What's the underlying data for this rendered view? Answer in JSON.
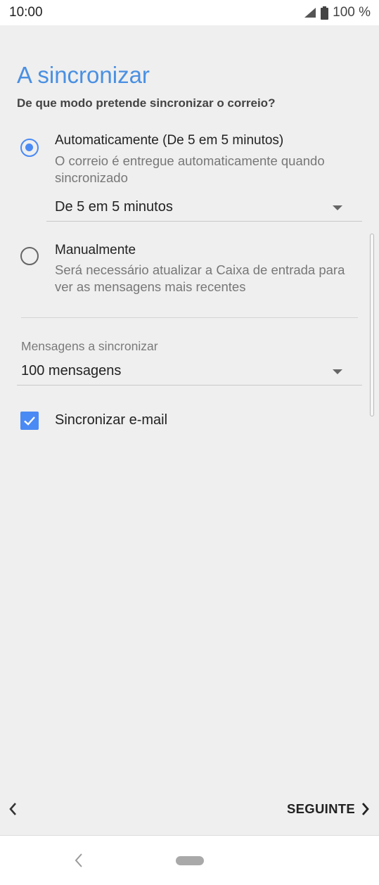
{
  "status_bar": {
    "time": "10:00",
    "battery": "100 %",
    "icons": [
      "signal-icon",
      "battery-icon"
    ]
  },
  "page": {
    "title": "A sincronizar",
    "subtitle": "De que modo pretende sincronizar o correio?"
  },
  "sync_options": [
    {
      "title": "Automaticamente (De 5 em 5 minutos)",
      "description": "O correio é entregue automaticamente quando sincronizado",
      "selected": true
    },
    {
      "title": "Manualmente",
      "description": "Será necessário atualizar a Caixa de entrada para ver as mensagens mais recentes",
      "selected": false
    }
  ],
  "interval_dropdown": {
    "value": "De 5 em 5 minutos"
  },
  "messages_field": {
    "label": "Mensagens a sincronizar",
    "value": "100 mensagens"
  },
  "sync_email": {
    "label": "Sincronizar e-mail",
    "checked": true
  },
  "footer": {
    "next_label": "SEGUINTE"
  },
  "colors": {
    "accent": "#4a8af4",
    "title": "#4a90e2"
  }
}
